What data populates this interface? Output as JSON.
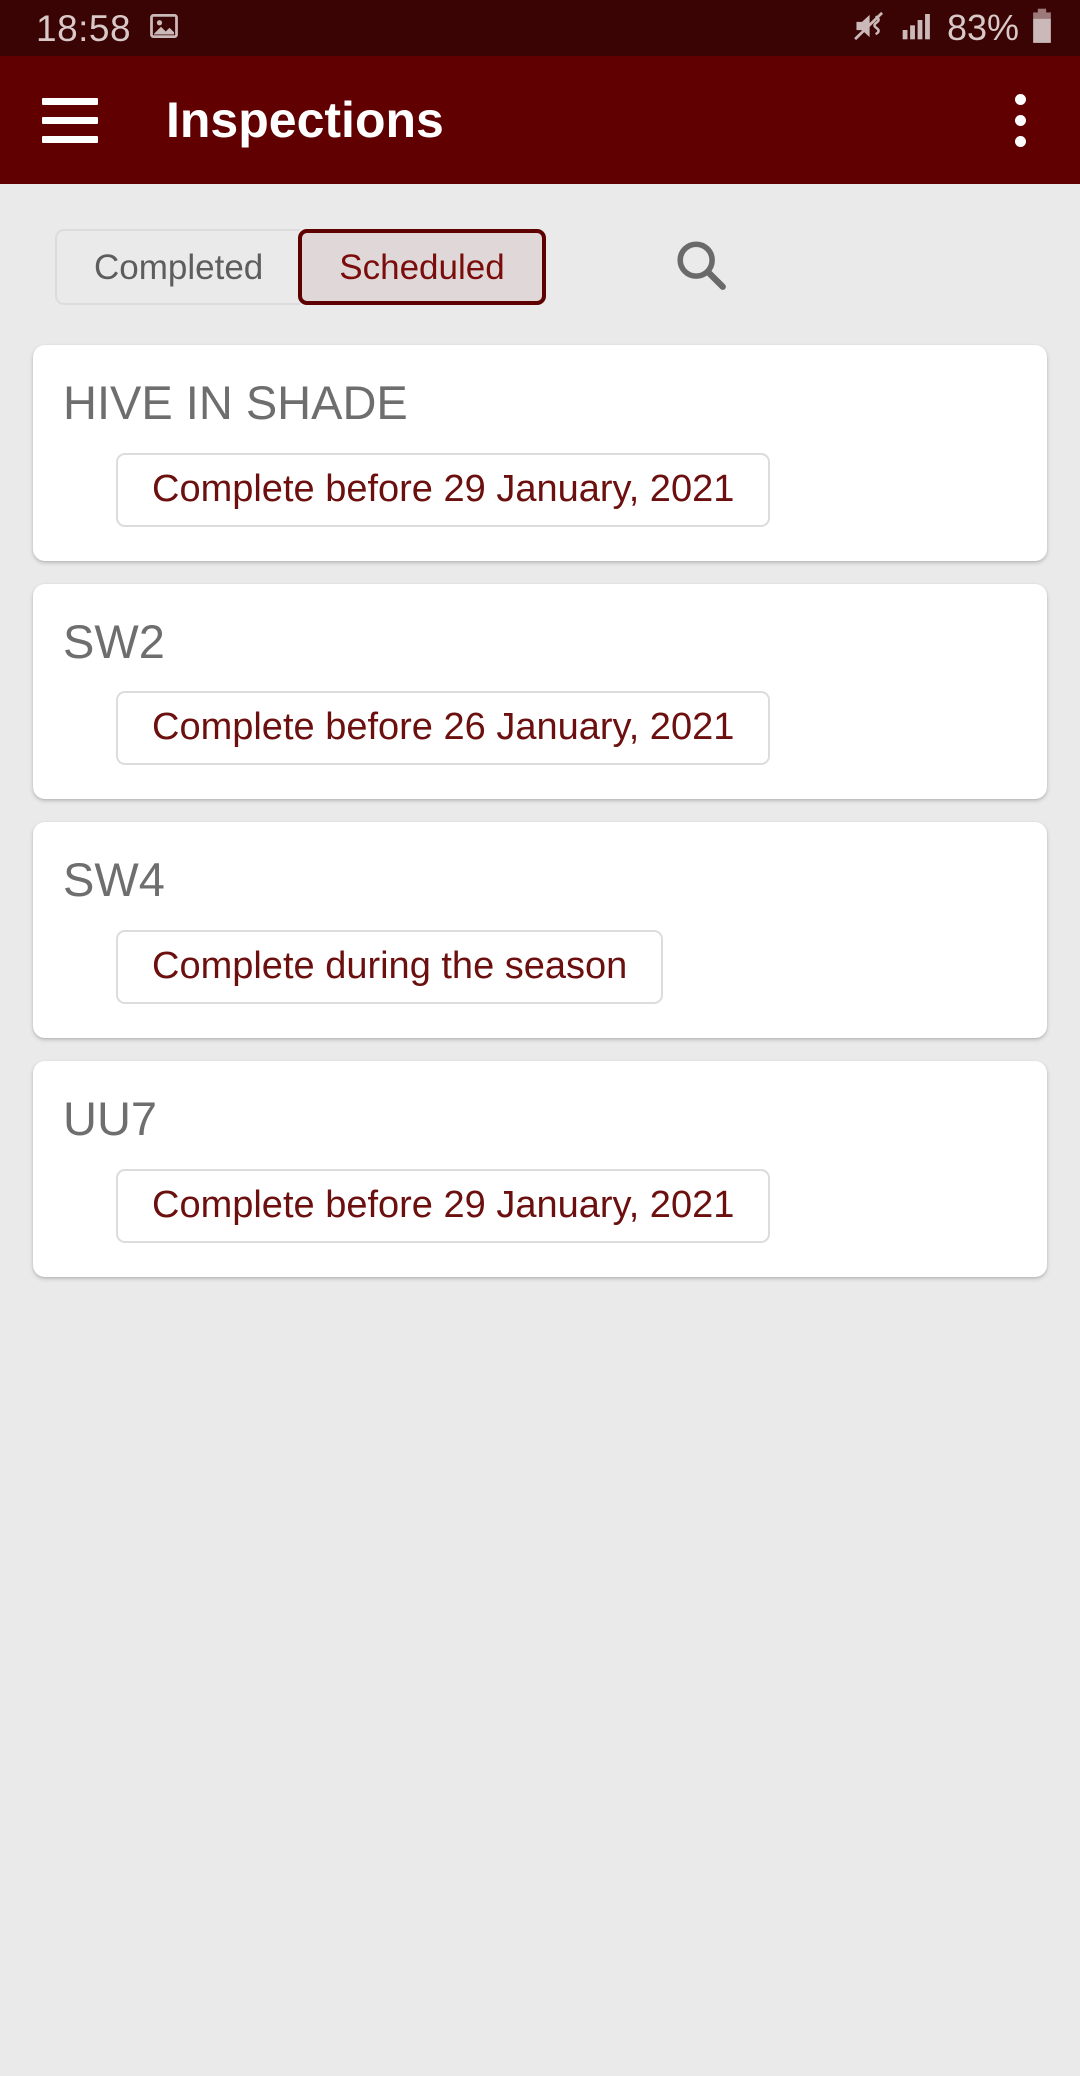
{
  "status_bar": {
    "time": "18:58",
    "photo_icon": "photo-icon",
    "mute_icon": "vibrate-mute-icon",
    "signal_icon": "signal-bars-icon",
    "battery_percent": "83%",
    "battery_icon": "battery-icon",
    "background_color": "#3a0404",
    "text_color": "#d9c8c8"
  },
  "app_bar": {
    "menu_icon": "hamburger-menu-icon",
    "title": "Inspections",
    "overflow_icon": "overflow-menu-icon",
    "background_color": "#600000",
    "title_color": "#ffffff"
  },
  "toolbar": {
    "tabs": [
      {
        "label": "Completed",
        "selected": false
      },
      {
        "label": "Scheduled",
        "selected": true
      }
    ],
    "search_icon": "search-icon",
    "active_tab_border_color": "#5e0000",
    "active_tab_text_color": "#7a0c0c",
    "inactive_tab_text_color": "#5d5d5d"
  },
  "inspections": [
    {
      "title": "HIVE IN SHADE",
      "due_label": "Complete before 29 January, 2021"
    },
    {
      "title": "SW2",
      "due_label": "Complete before 26 January, 2021"
    },
    {
      "title": "SW4",
      "due_label": "Complete during the season"
    },
    {
      "title": "UU7",
      "due_label": "Complete before 29 January, 2021"
    }
  ],
  "theme": {
    "page_background": "#eaeaea",
    "card_background": "#ffffff",
    "card_title_color": "#6e6e6e",
    "chip_text_color": "#6b0f0f",
    "chip_border_color": "#dcdcdc"
  }
}
